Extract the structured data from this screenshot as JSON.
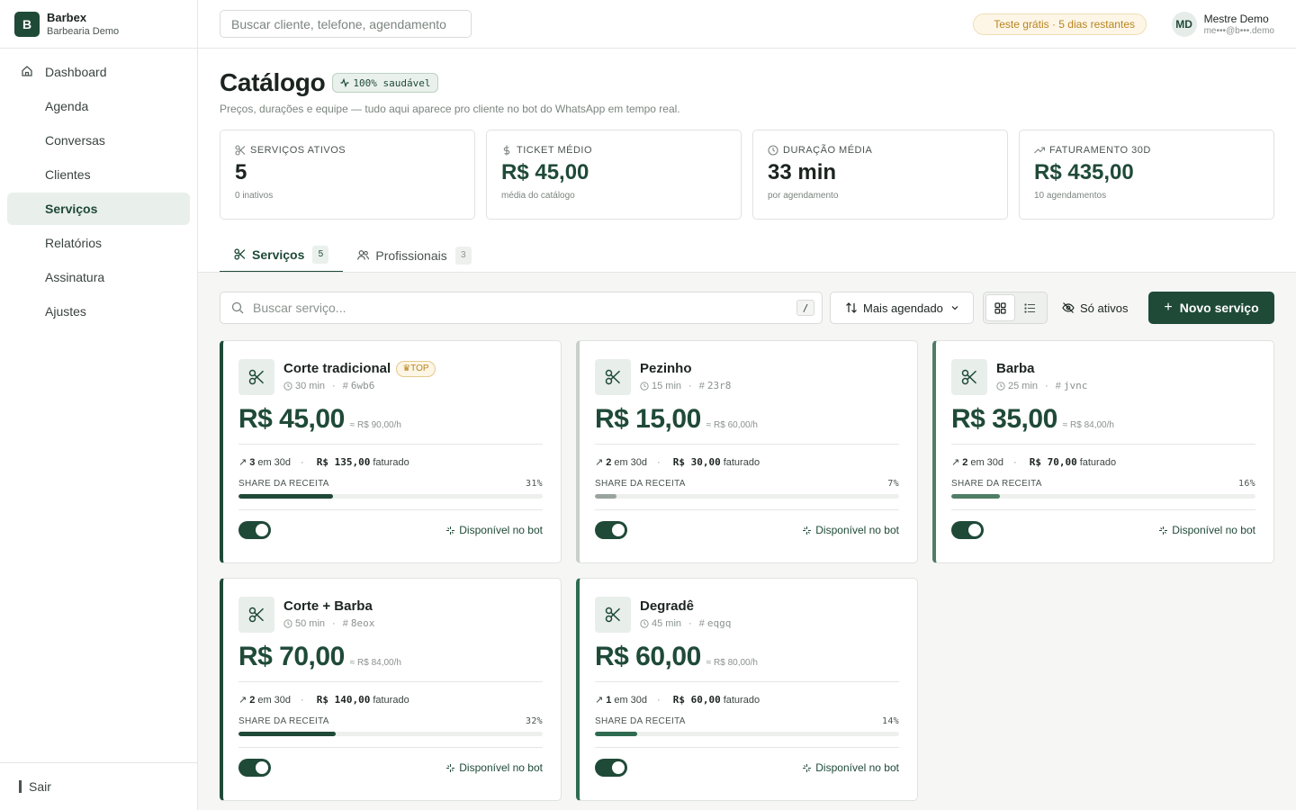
{
  "brand": {
    "logo_letter": "B",
    "name": "Barbex",
    "subtitle": "Barbearia Demo"
  },
  "sidebar": {
    "items": [
      {
        "label": "Dashboard",
        "icon": "home-icon",
        "active": false
      },
      {
        "label": "Agenda",
        "active": false
      },
      {
        "label": "Conversas",
        "active": false
      },
      {
        "label": "Clientes",
        "active": false
      },
      {
        "label": "Serviços",
        "active": true
      },
      {
        "label": "Relatórios",
        "active": false
      },
      {
        "label": "Assinatura",
        "active": false
      },
      {
        "label": "Ajustes",
        "active": false
      }
    ],
    "logout": "Sair"
  },
  "topbar": {
    "search_placeholder": "Buscar cliente, telefone, agendamento",
    "trial": "Teste grátis · 5 dias restantes",
    "user": {
      "initials": "MD",
      "name": "Mestre Demo",
      "email": "me•••@b•••.demo"
    }
  },
  "page": {
    "title": "Catálogo",
    "health": "100% saudável",
    "subtitle": "Preços, durações e equipe — tudo aqui aparece pro cliente no bot do WhatsApp em tempo real."
  },
  "stats": [
    {
      "label": "SERVIÇOS ATIVOS",
      "value": "5",
      "note": "0 inativos",
      "icon": "scissors-icon"
    },
    {
      "label": "TICKET MÉDIO",
      "value": "R$ 45,00",
      "note": "média do catálogo",
      "icon": "dollar-icon"
    },
    {
      "label": "DURAÇÃO MÉDIA",
      "value": "33 min",
      "note": "por agendamento",
      "icon": "clock-icon"
    },
    {
      "label": "FATURAMENTO 30D",
      "value": "R$ 435,00",
      "note": "10 agendamentos",
      "icon": "trending-up-icon"
    }
  ],
  "tabs": [
    {
      "label": "Serviços",
      "count": "5",
      "active": true
    },
    {
      "label": "Profissionais",
      "count": "3",
      "active": false
    }
  ],
  "toolbar": {
    "search_placeholder": "Buscar serviço...",
    "shortcut": "/",
    "sort_label": "Mais agendado",
    "active_only": "Só ativos",
    "new_button": "Novo serviço",
    "new_plus": "+"
  },
  "services": [
    {
      "name": "Corte tradicional",
      "badge": "TOP",
      "duration": "30 min",
      "code": "6wb6",
      "price": "R$ 45,00",
      "per_hour": "≈ R$ 90,00/h",
      "count": "3",
      "count_suffix": "em 30d",
      "revenue": "R$ 135,00",
      "revenue_suffix": "faturado",
      "share_label": "SHARE DA RECEITA",
      "share": "31%",
      "share_value": 31,
      "bot": "Disponível no bot",
      "enabled": true,
      "accent": "#1f4a38"
    },
    {
      "name": "Pezinho",
      "badge": "",
      "duration": "15 min",
      "code": "23r8",
      "price": "R$ 15,00",
      "per_hour": "≈ R$ 60,00/h",
      "count": "2",
      "count_suffix": "em 30d",
      "revenue": "R$ 30,00",
      "revenue_suffix": "faturado",
      "share_label": "SHARE DA RECEITA",
      "share": "7%",
      "share_value": 7,
      "bot": "Disponível no bot",
      "enabled": true,
      "accent": "#c9cfca"
    },
    {
      "name": "Barba",
      "badge": "",
      "duration": "25 min",
      "code": "jvnc",
      "price": "R$ 35,00",
      "per_hour": "≈ R$ 84,00/h",
      "count": "2",
      "count_suffix": "em 30d",
      "revenue": "R$ 70,00",
      "revenue_suffix": "faturado",
      "share_label": "SHARE DA RECEITA",
      "share": "16%",
      "share_value": 16,
      "bot": "Disponível no bot",
      "enabled": true,
      "accent": "#4f7d66"
    },
    {
      "name": "Corte + Barba",
      "badge": "",
      "duration": "50 min",
      "code": "8eox",
      "price": "R$ 70,00",
      "per_hour": "≈ R$ 84,00/h",
      "count": "2",
      "count_suffix": "em 30d",
      "revenue": "R$ 140,00",
      "revenue_suffix": "faturado",
      "share_label": "SHARE DA RECEITA",
      "share": "32%",
      "share_value": 32,
      "bot": "Disponível no bot",
      "enabled": true,
      "accent": "#1f4a38"
    },
    {
      "name": "Degradê",
      "badge": "",
      "duration": "45 min",
      "code": "eqgq",
      "price": "R$ 60,00",
      "per_hour": "≈ R$ 80,00/h",
      "count": "1",
      "count_suffix": "em 30d",
      "revenue": "R$ 60,00",
      "revenue_suffix": "faturado",
      "share_label": "SHARE DA RECEITA",
      "share": "14%",
      "share_value": 14,
      "bot": "Disponível no bot",
      "enabled": true,
      "accent": "#2e6b50"
    }
  ]
}
